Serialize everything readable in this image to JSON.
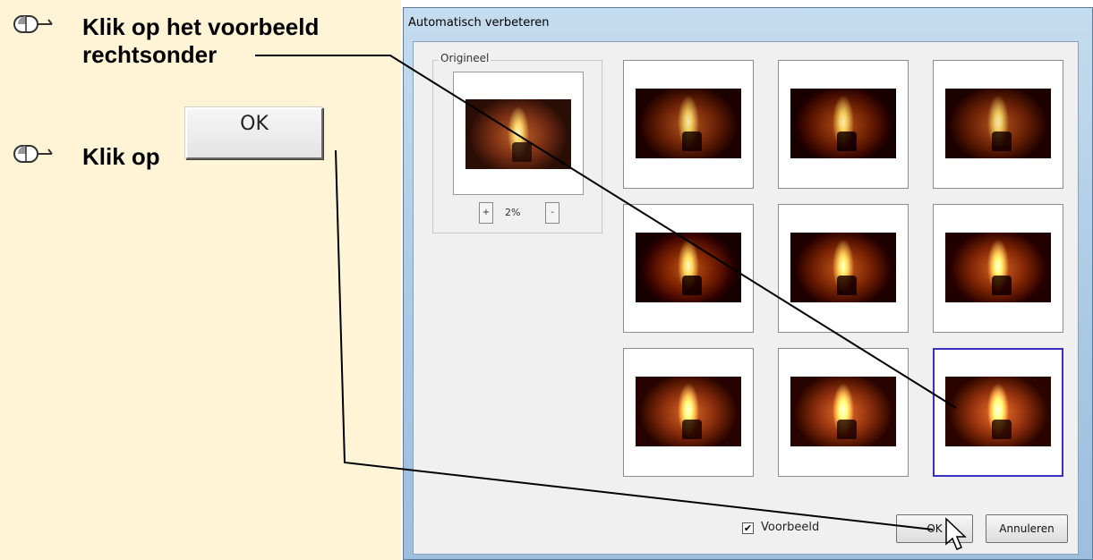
{
  "instructions": {
    "step1_line1": "Klik op het voorbeeld",
    "step1_line2": "rechtsonder",
    "step2_text": "Klik op",
    "ok_button_large": "OK",
    "icon": "mouse-left-click-icon"
  },
  "dialog": {
    "title": "Automatisch verbeteren",
    "group_label": "Origineel",
    "zoom_in": "+",
    "zoom_value": "2%",
    "zoom_out": "-",
    "thumbnails_selected": "bottom-right",
    "preview_checkbox_label": "Voorbeeld",
    "preview_checked": true,
    "ok_label": "OK",
    "cancel_label": "Annuleren"
  },
  "colors": {
    "instruction_bg": "#fff5d6",
    "selected_thumbnail_border": "#3a2fc0"
  }
}
